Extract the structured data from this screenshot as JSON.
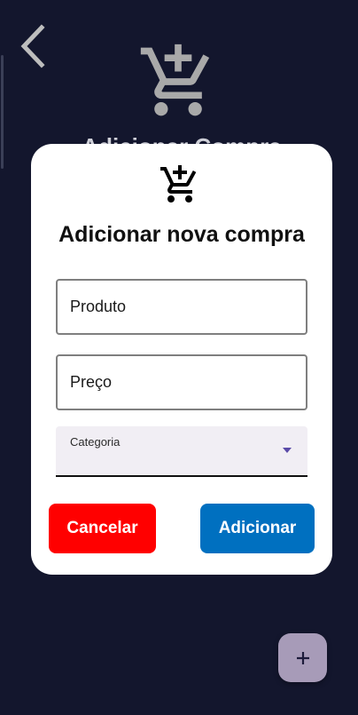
{
  "screen": {
    "background_color": "#13162d",
    "title_ghost": "Adicionar Compra"
  },
  "header": {
    "back_icon": "chevron-left-icon",
    "cart_icon": "add-shopping-cart-icon"
  },
  "dialog": {
    "icon": "add-shopping-cart-icon",
    "title": "Adicionar nova compra",
    "fields": {
      "produto_placeholder": "Produto",
      "preco_placeholder": "Preço"
    },
    "category": {
      "label": "Categoria",
      "selected": ""
    },
    "buttons": {
      "cancel_label": "Cancelar",
      "add_label": "Adicionar"
    }
  },
  "colors": {
    "cancel": "#ff0000",
    "add": "#0070c0",
    "fab": "#a79bb8"
  },
  "fab": {
    "icon": "plus-icon"
  }
}
